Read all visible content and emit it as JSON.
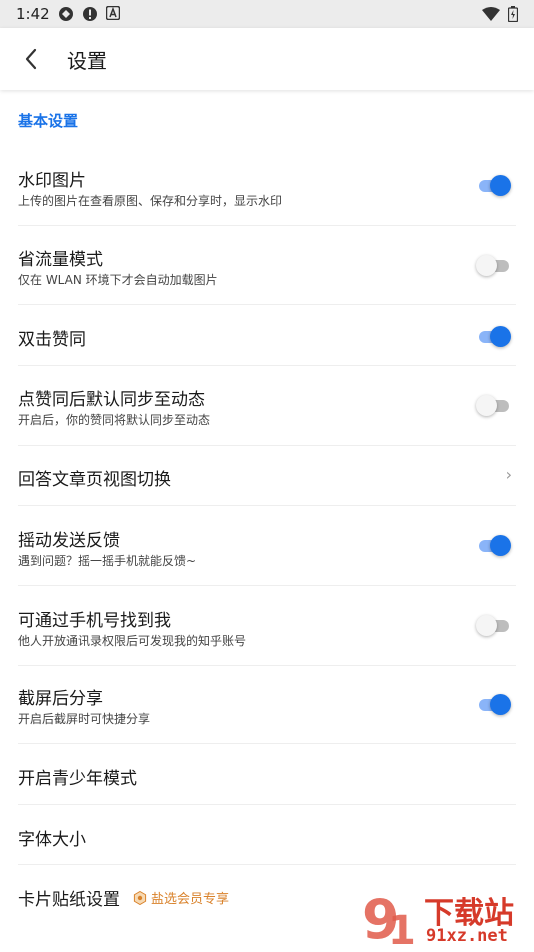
{
  "status_bar": {
    "time": "1:42"
  },
  "app_bar": {
    "title": "设置"
  },
  "section": {
    "header": "基本设置"
  },
  "rows": [
    {
      "title": "水印图片",
      "subtitle": "上传的图片在查看原图、保存和分享时，显示水印",
      "control": "toggle",
      "state": "on"
    },
    {
      "title": "省流量模式",
      "subtitle": "仅在 WLAN 环境下才会自动加载图片",
      "control": "toggle",
      "state": "off"
    },
    {
      "title": "双击赞同",
      "subtitle": "",
      "control": "toggle",
      "state": "on"
    },
    {
      "title": "点赞同后默认同步至动态",
      "subtitle": "开启后，你的赞同将默认同步至动态",
      "control": "toggle",
      "state": "off"
    },
    {
      "title": "回答文章页视图切换",
      "subtitle": "",
      "control": "chevron"
    },
    {
      "title": "摇动发送反馈",
      "subtitle": "遇到问题？摇一摇手机就能反馈~",
      "control": "toggle",
      "state": "on"
    },
    {
      "title": "可通过手机号找到我",
      "subtitle": "他人开放通讯录权限后可发现我的知乎账号",
      "control": "toggle",
      "state": "off"
    },
    {
      "title": "截屏后分享",
      "subtitle": "开启后截屏时可快捷分享",
      "control": "toggle",
      "state": "on"
    },
    {
      "title": "开启青少年模式",
      "subtitle": "",
      "control": "none"
    },
    {
      "title": "字体大小",
      "subtitle": "",
      "control": "none"
    },
    {
      "title": "卡片贴纸设置",
      "subtitle": "",
      "control": "badge",
      "badge": "盐选会员专享"
    }
  ],
  "watermark": {
    "line1": "下载站",
    "line2": "91xz.net"
  },
  "colors": {
    "accent": "#1a73e8",
    "accent_track": "#8ab4f8",
    "badge": "#d9822b"
  }
}
